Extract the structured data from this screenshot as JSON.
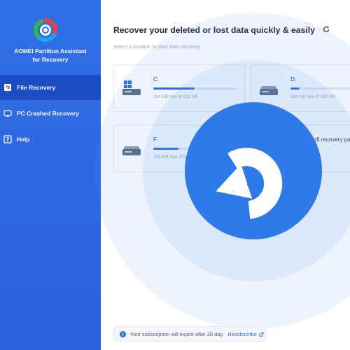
{
  "app": {
    "title_line1": "AOMEI Partition Assistant",
    "title_line2": "for Recovery"
  },
  "sidebar": {
    "items": [
      {
        "label": "File Recovery",
        "icon": "file-recovery-icon",
        "active": true
      },
      {
        "label": "PC Crashed Recovery",
        "icon": "monitor-icon",
        "active": false
      },
      {
        "label": "Help",
        "icon": "help-icon",
        "active": false
      }
    ]
  },
  "main": {
    "title": "Recover your deleted or lost data quickly & easily",
    "subtitle": "Select a location to start data recovery",
    "drives": [
      {
        "label": "C:",
        "free": "114 GB free of 223 GB",
        "used_fraction": 0.49,
        "icon": "windows-drive-icon"
      },
      {
        "label": "D:",
        "free": "259 GB free of 290 GB",
        "used_fraction": 0.11,
        "icon": "drive-icon"
      },
      {
        "label": "F:",
        "free": "205 MB free of 9...",
        "used_fraction": 0.3,
        "icon": "drive-icon"
      },
      {
        "label": "...soft recovery pa...",
        "free": "",
        "used_fraction": 0.0,
        "icon": "drive-icon"
      }
    ]
  },
  "notice": {
    "text": "Your subscription will expire after 28 day.",
    "link": "Resubscribe"
  },
  "colors": {
    "sidebar": "#2f6fe6",
    "active_item": "#1b4cc4",
    "accent": "#2b6de3",
    "overlay_circle": "#2d7ae8"
  }
}
